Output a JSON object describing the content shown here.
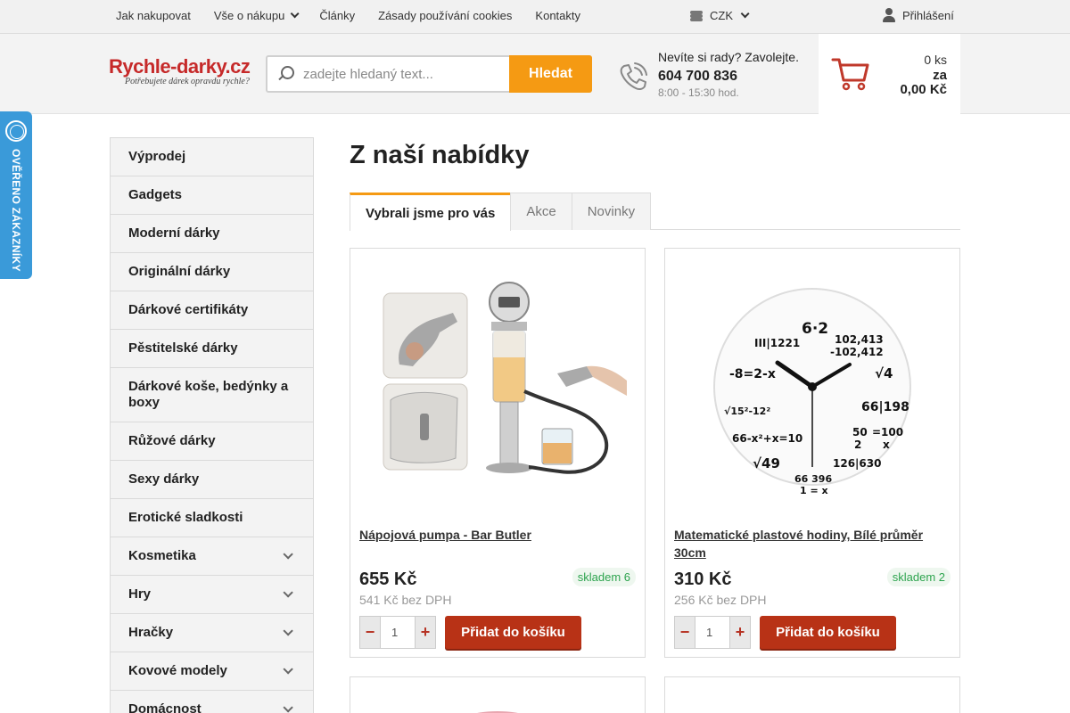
{
  "topnav": {
    "items": [
      {
        "label": "Jak nakupovat",
        "dropdown": false
      },
      {
        "label": "Vše o nákupu",
        "dropdown": true
      },
      {
        "label": "Články",
        "dropdown": false
      },
      {
        "label": "Zásady používání cookies",
        "dropdown": false
      },
      {
        "label": "Kontakty",
        "dropdown": false
      }
    ],
    "currency": "CZK",
    "login": "Přihlášení"
  },
  "header": {
    "logo_main": "Rychle-darky.cz",
    "logo_sub": "Potřebujete dárek opravdu rychle?",
    "search_placeholder": "zadejte hledaný text...",
    "search_button": "Hledat",
    "contact_question": "Nevíte si rady? Zavolejte.",
    "phone": "604 700 836",
    "hours": "8:00 - 15:30 hod.",
    "cart_count": "0 ks",
    "cart_za": "za",
    "cart_total": "0,00 Kč"
  },
  "verified_badge": "OVĚŘENO ZÁKAZNÍKY",
  "sidebar": {
    "items": [
      {
        "label": "Výprodej",
        "has_sub": false
      },
      {
        "label": "Gadgets",
        "has_sub": false
      },
      {
        "label": "Moderní dárky",
        "has_sub": false
      },
      {
        "label": "Originální dárky",
        "has_sub": false
      },
      {
        "label": "Dárkové certifikáty",
        "has_sub": false
      },
      {
        "label": "Pěstitelské dárky",
        "has_sub": false
      },
      {
        "label": "Dárkové koše, bedýnky a boxy",
        "has_sub": false
      },
      {
        "label": "Růžové dárky",
        "has_sub": false
      },
      {
        "label": "Sexy dárky",
        "has_sub": false
      },
      {
        "label": "Erotické sladkosti",
        "has_sub": false
      },
      {
        "label": "Kosmetika",
        "has_sub": true
      },
      {
        "label": "Hry",
        "has_sub": true
      },
      {
        "label": "Hračky",
        "has_sub": true
      },
      {
        "label": "Kovové modely",
        "has_sub": true
      },
      {
        "label": "Domácnost",
        "has_sub": true
      }
    ]
  },
  "main": {
    "title": "Z naší nabídky",
    "tabs": [
      {
        "label": "Vybrali jsme pro vás",
        "active": true
      },
      {
        "label": "Akce",
        "active": false
      },
      {
        "label": "Novinky",
        "active": false
      }
    ],
    "products": [
      {
        "name": "Nápojová pumpa - Bar Butler",
        "price": "655 Kč",
        "price_vat": "541 Kč bez DPH",
        "stock": "skladem 6",
        "qty": "1",
        "add_label": "Přidat do košíku"
      },
      {
        "name": "Matematické plastové hodiny, Bílé průměr 30cm",
        "price": "310 Kč",
        "price_vat": "256 Kč bez DPH",
        "stock": "skladem 2",
        "qty": "1",
        "add_label": "Přidat do košíku"
      }
    ],
    "clock_labels": [
      "6·2",
      "III|1221",
      "102,413",
      "-102,412",
      "-8=2-x",
      "√4",
      "√15²-12²",
      "66|198",
      "66-x²+x=10",
      "50",
      "2",
      "=100",
      "x",
      "√49",
      "126|630",
      "66 396",
      "1 = x"
    ]
  },
  "colors": {
    "accent_orange": "#f59a13",
    "add_button": "#b83216",
    "logo_red": "#c62a2a",
    "badge_blue": "#3a9ad9",
    "stock_green": "#2ea44f"
  }
}
